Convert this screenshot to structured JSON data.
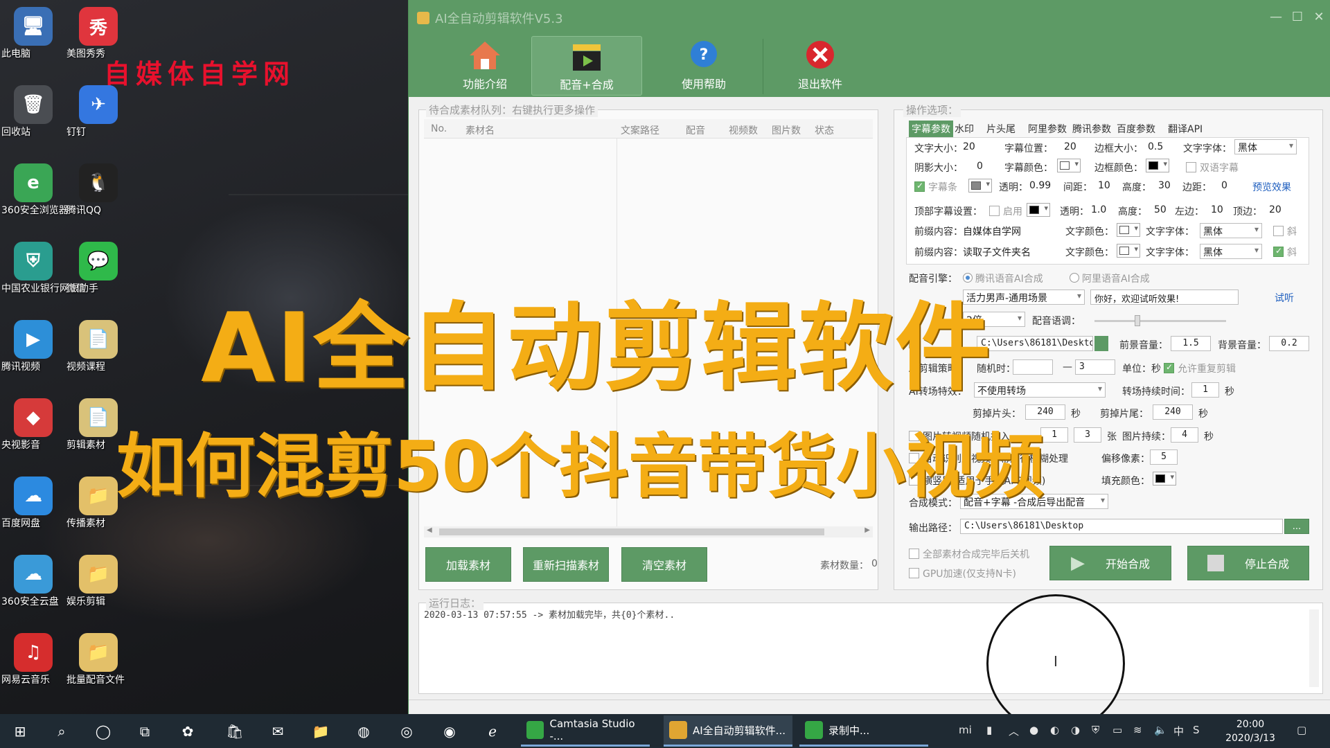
{
  "desktop": {
    "watermark": "自媒体自学网",
    "icons_left": [
      {
        "label": "此电脑",
        "icon": "computer-icon",
        "glyph": "🖥"
      },
      {
        "label": "回收站",
        "icon": "recycle-bin-icon",
        "glyph": "🗑"
      },
      {
        "label": "360安全浏览器",
        "icon": "browser-360-icon",
        "glyph": "e"
      },
      {
        "label": "中国农业银行网银助手",
        "icon": "bank-icon",
        "glyph": "⛨"
      },
      {
        "label": "腾讯视频",
        "icon": "tencent-video-icon",
        "glyph": "▶"
      },
      {
        "label": "央视影音",
        "icon": "cctv-icon",
        "glyph": "◆"
      },
      {
        "label": "百度网盘",
        "icon": "baidu-pan-icon",
        "glyph": "☁"
      },
      {
        "label": "360安全云盘",
        "icon": "cloud-360-icon",
        "glyph": "☁"
      },
      {
        "label": "网易云音乐",
        "icon": "netease-music-icon",
        "glyph": "♫"
      }
    ],
    "icons_right": [
      {
        "label": "美图秀秀",
        "icon": "meitu-icon",
        "glyph": "秀"
      },
      {
        "label": "钉钉",
        "icon": "dingtalk-icon",
        "glyph": "✈"
      },
      {
        "label": "腾讯QQ",
        "icon": "qq-icon",
        "glyph": "🐧"
      },
      {
        "label": "微信",
        "icon": "wechat-icon",
        "glyph": "💬"
      },
      {
        "label": "视频课程",
        "icon": "file-icon",
        "glyph": "📄"
      },
      {
        "label": "剪辑素材",
        "icon": "file-icon",
        "glyph": "📄"
      },
      {
        "label": "传播素材",
        "icon": "folder-icon",
        "glyph": "📁"
      },
      {
        "label": "娱乐剪辑",
        "icon": "folder-icon",
        "glyph": "📁"
      },
      {
        "label": "批量配音文件",
        "icon": "folder-icon",
        "glyph": "📁"
      }
    ]
  },
  "overlay": {
    "line1": "AI全自动剪辑软件",
    "line2": "如何混剪50个抖音带货小视频"
  },
  "window": {
    "title": "AI全自动剪辑软件V5.3"
  },
  "toolbar": {
    "buttons": [
      "功能介绍",
      "配音+合成",
      "使用帮助",
      "退出软件"
    ]
  },
  "queue": {
    "legend": "待合成素材队列：右键执行更多操作",
    "columns": [
      "No.",
      "素材名",
      "文案路径",
      "配音",
      "视频数",
      "图片数",
      "状态"
    ],
    "load_btn": "加载素材",
    "rescan_btn": "重新扫描素材",
    "clear_btn": "清空素材",
    "count_label": "素材数量：",
    "count_value": "0"
  },
  "options": {
    "legend": "操作选项：",
    "tabs": [
      "字幕参数",
      "水印",
      "片头尾",
      "阿里参数",
      "腾讯参数",
      "百度参数",
      "翻译API"
    ],
    "row1": {
      "font_size_l": "文字大小：",
      "font_size": "20",
      "pos_l": "字幕位置：",
      "pos": "20",
      "border_l": "边框大小：",
      "border": "0.5",
      "font_l": "文字字体：",
      "font": "黑体"
    },
    "row2": {
      "shadow_l": "阴影大小：",
      "shadow": "0",
      "color_l": "字幕颜色：",
      "bcolor_l": "边框颜色：",
      "dual": "双语字幕"
    },
    "row3": {
      "bar": "字幕条",
      "alpha_l": "透明：",
      "alpha": "0.99",
      "gap_l": "间距：",
      "gap": "10",
      "h_l": "高度：",
      "h": "30",
      "edge_l": "边距：",
      "edge": "0",
      "preview": "预览效果"
    },
    "row4": {
      "top_l": "顶部字幕设置：",
      "enable": "启用",
      "alpha_l": "透明：",
      "alpha": "1.0",
      "h_l": "高度：",
      "h": "50",
      "left_l": "左边：",
      "left": "10",
      "topm_l": "顶边：",
      "topm": "20"
    },
    "row5": {
      "prefix_l": "前缀内容：",
      "prefix": "自媒体自学网",
      "color_l": "文字颜色：",
      "font_l": "文字字体：",
      "font": "黑体",
      "italic": "斜"
    },
    "row6": {
      "prefix_l": "前缀内容：",
      "prefix": "读取子文件夹名",
      "color_l": "文字颜色：",
      "font_l": "文字字体：",
      "font": "黑体",
      "italic": "斜"
    },
    "engine_l": "配音引擎：",
    "engine_opts": [
      "腾讯语音AI合成",
      "阿里语音AI合成"
    ],
    "voice": "活力男声-通用场景",
    "test_text": "你好，欢迎试听效果!",
    "listen": "试听",
    "speed_val": "2倍",
    "speed_l2": "配音语调：",
    "bgm_path": "C:\\Users\\86181\\Desktop",
    "fg_vol_l": "前景音量：",
    "fg_vol": "1.5",
    "bg_vol_l": "背景音量：",
    "bg_vol": "0.2",
    "cut_l": "AI剪辑策略：",
    "cut_rand": "随机时：",
    "cut_dash": "—",
    "cut_max": "3",
    "cut_unit": "单位：秒",
    "allow_repeat": "允许重复剪辑",
    "trans_l": "AI转场特效：",
    "trans": "不使用转场",
    "trans_dur_l": "转场持续时间：",
    "trans_dur": "1",
    "sec": "秒",
    "cut_head_l": "剪掉片头：",
    "cut_head": "240",
    "cut_tail_l": "剪掉片尾：",
    "cut_tail": "240",
    "img_insert": "图片转视频随机插入",
    "img_min": "1",
    "img_max": "3",
    "img_unit": "张",
    "img_dur_l": "图片持续：",
    "img_dur": "4",
    "auto_sub": "自动识别原视频字幕进行模糊处理",
    "offset_l": "偏移像素：",
    "offset": "5",
    "vertical": "横竖屏(适用于手机APP视频)",
    "fill_l": "填充颜色：",
    "mode_l": "合成模式：",
    "mode": "配音+字幕 -合成后导出配音",
    "out_l": "输出路径：",
    "out_path": "C:\\Users\\86181\\Desktop",
    "out_btn": "...",
    "shutdown": "全部素材合成完毕后关机",
    "gpu": "GPU加速(仅支持N卡)",
    "start": "开始合成",
    "stop": "停止合成"
  },
  "log": {
    "legend": "运行日志：",
    "line": "2020-03-13 07:57:55 -> 素材加载完毕，共{0}个素材.."
  },
  "taskbar": {
    "apps": [
      "Camtasia Studio -...",
      "AI全自动剪辑软件...",
      "录制中..."
    ],
    "time": "20:00",
    "date": "2020/3/13",
    "lang": "中"
  },
  "colors": {
    "accent": "#5d9a65",
    "overlay": "#f4ad15",
    "watermark": "#e8112d"
  }
}
